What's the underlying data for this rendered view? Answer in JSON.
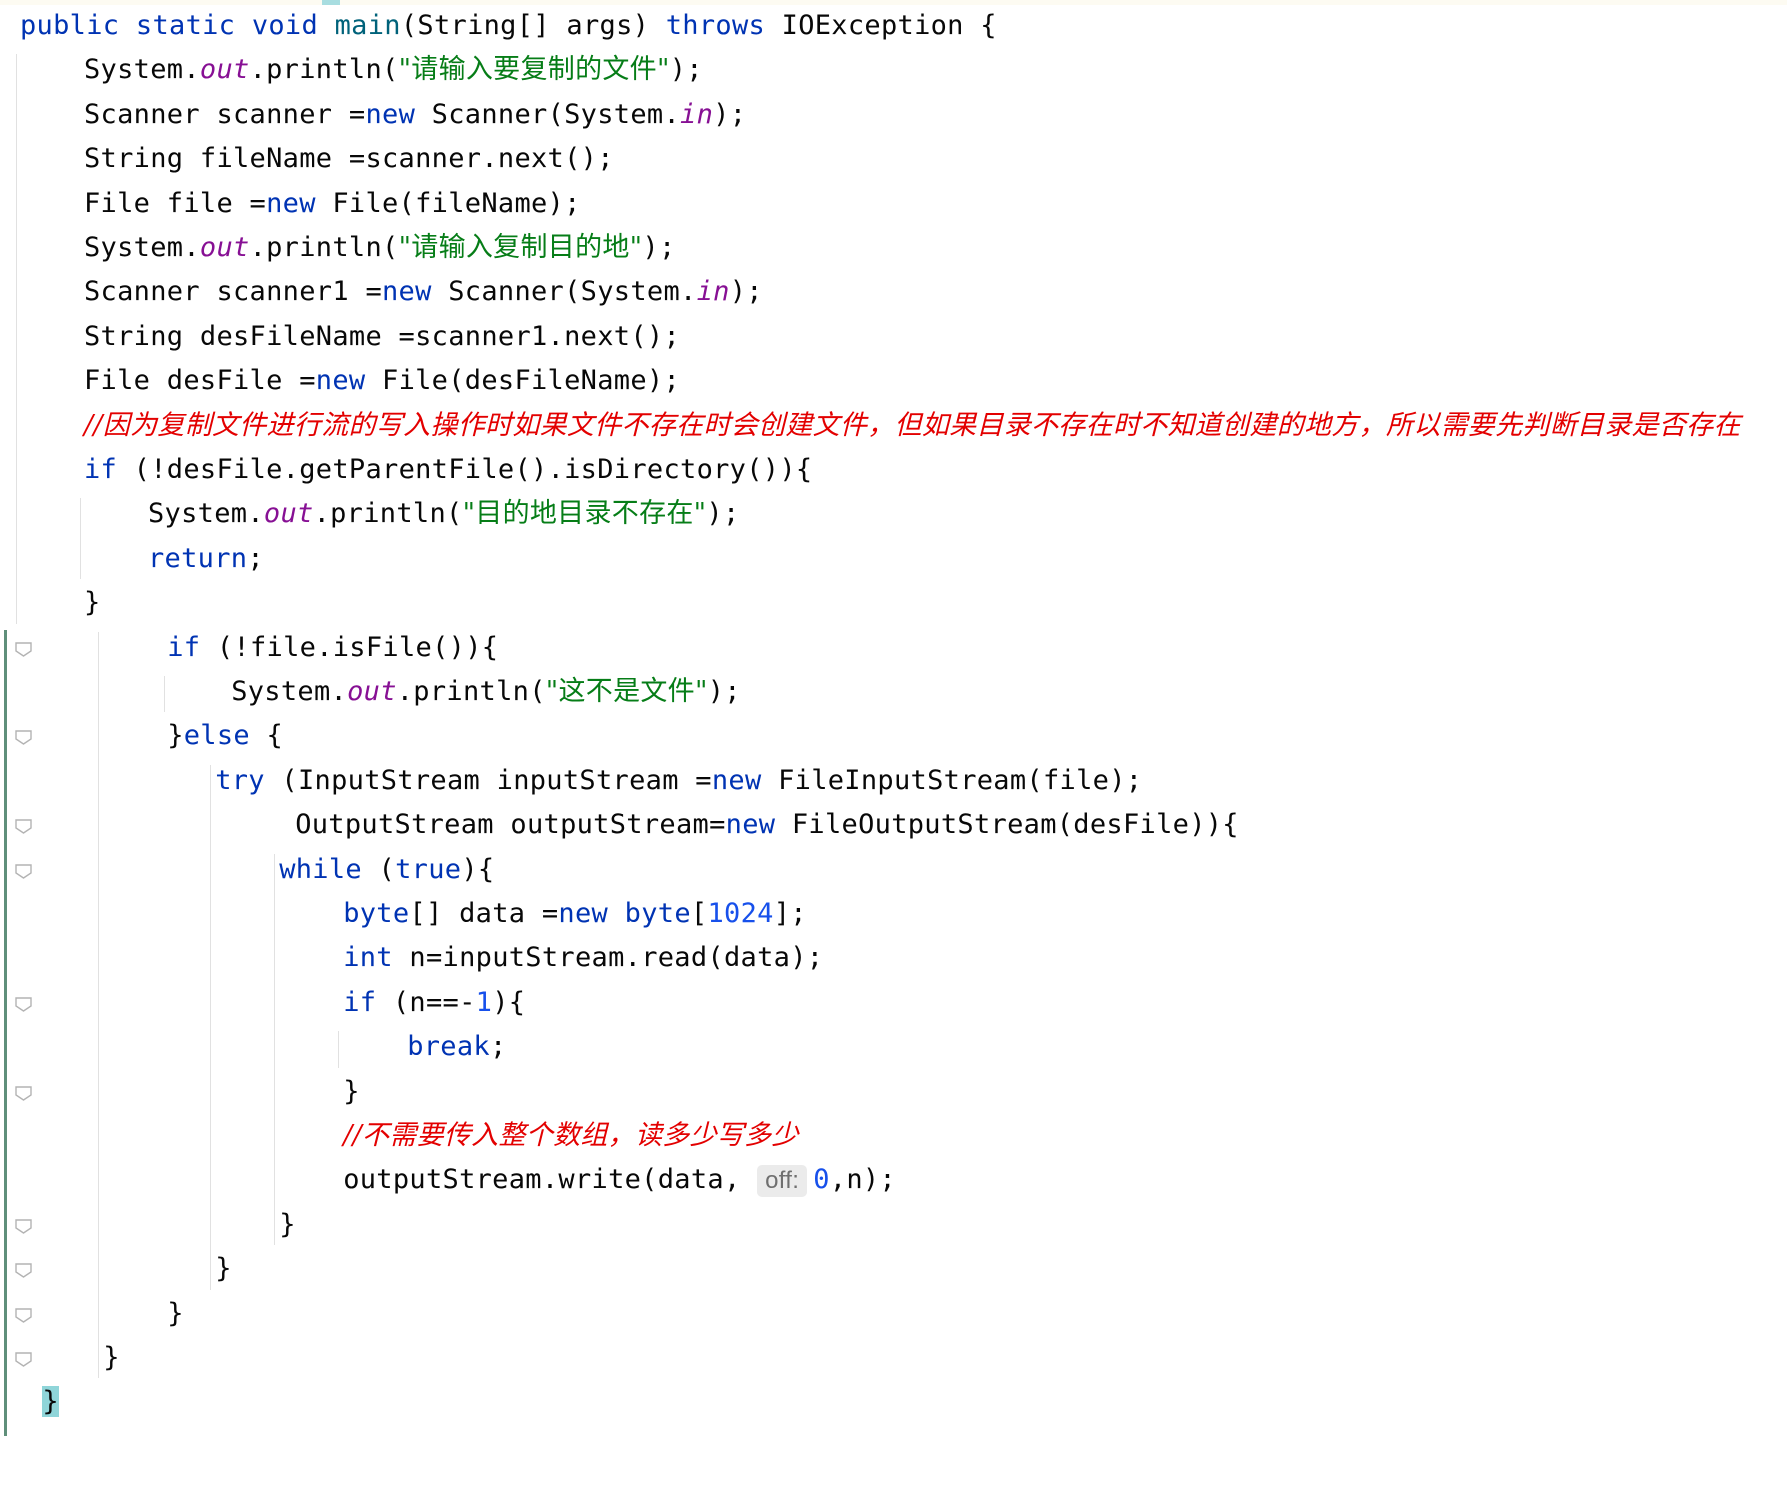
{
  "editor": {
    "language": "Java",
    "colors": {
      "keyword": "#0033b3",
      "string": "#067d17",
      "comment": "#e30000",
      "static_field": "#871094",
      "method_decl": "#00627a",
      "number": "#1750eb",
      "brace_highlight": "#8fd5d9",
      "change_bar": "#5f8f7a"
    },
    "lines": [
      {
        "indent": 0,
        "tokens": [
          {
            "t": "public",
            "c": "kw"
          },
          {
            "t": " "
          },
          {
            "t": "static",
            "c": "kw"
          },
          {
            "t": " "
          },
          {
            "t": "void",
            "c": "kw"
          },
          {
            "t": " "
          },
          {
            "t": "main",
            "c": "fn"
          },
          {
            "t": "(String[] args) "
          },
          {
            "t": "throws",
            "c": "kw"
          },
          {
            "t": " IOException {"
          }
        ]
      },
      {
        "indent": 1,
        "tokens": [
          {
            "t": "System."
          },
          {
            "t": "out",
            "c": "fld"
          },
          {
            "t": ".println("
          },
          {
            "t": "\"请输入要复制的文件\"",
            "c": "str"
          },
          {
            "t": ");"
          }
        ]
      },
      {
        "indent": 1,
        "tokens": [
          {
            "t": "Scanner scanner ="
          },
          {
            "t": "new",
            "c": "kw"
          },
          {
            "t": " Scanner(System."
          },
          {
            "t": "in",
            "c": "fld"
          },
          {
            "t": ");"
          }
        ]
      },
      {
        "indent": 1,
        "tokens": [
          {
            "t": "String fileName =scanner.next();"
          }
        ]
      },
      {
        "indent": 1,
        "tokens": [
          {
            "t": "File file ="
          },
          {
            "t": "new",
            "c": "kw"
          },
          {
            "t": " File(fileName);"
          }
        ]
      },
      {
        "indent": 1,
        "tokens": [
          {
            "t": "System."
          },
          {
            "t": "out",
            "c": "fld"
          },
          {
            "t": ".println("
          },
          {
            "t": "\"请输入复制目的地\"",
            "c": "str"
          },
          {
            "t": ");"
          }
        ]
      },
      {
        "indent": 1,
        "tokens": [
          {
            "t": "Scanner scanner1 ="
          },
          {
            "t": "new",
            "c": "kw"
          },
          {
            "t": " Scanner(System."
          },
          {
            "t": "in",
            "c": "fld"
          },
          {
            "t": ");"
          }
        ]
      },
      {
        "indent": 1,
        "tokens": [
          {
            "t": "String desFileName =scanner1.next();"
          }
        ]
      },
      {
        "indent": 1,
        "tokens": [
          {
            "t": "File desFile ="
          },
          {
            "t": "new",
            "c": "kw"
          },
          {
            "t": " File(desFileName);"
          }
        ]
      },
      {
        "indent": 1,
        "tokens": [
          {
            "t": "//因为复制文件进行流的写入操作时如果文件不存在时会创建文件，但如果目录不存在时不知道创建的地方，所以需要先判断目录是否存在",
            "c": "cmt"
          }
        ]
      },
      {
        "indent": 1,
        "tokens": [
          {
            "t": "if",
            "c": "kw"
          },
          {
            "t": " (!desFile.getParentFile().isDirectory()){"
          }
        ]
      },
      {
        "indent": 2,
        "tokens": [
          {
            "t": "System."
          },
          {
            "t": "out",
            "c": "fld"
          },
          {
            "t": ".println("
          },
          {
            "t": "\"目的地目录不存在\"",
            "c": "str"
          },
          {
            "t": ");"
          }
        ]
      },
      {
        "indent": 2,
        "tokens": [
          {
            "t": "return",
            "c": "kw"
          },
          {
            "t": ";"
          }
        ]
      },
      {
        "indent": 1,
        "tokens": [
          {
            "t": "}"
          }
        ]
      },
      {
        "indent": 2.3,
        "fold": true,
        "tokens": [
          {
            "t": "if",
            "c": "kw"
          },
          {
            "t": " (!file.isFile()){"
          }
        ]
      },
      {
        "indent": 3.3,
        "tokens": [
          {
            "t": "System."
          },
          {
            "t": "out",
            "c": "fld"
          },
          {
            "t": ".println("
          },
          {
            "t": "\"这不是文件\"",
            "c": "str"
          },
          {
            "t": ");"
          }
        ]
      },
      {
        "indent": 2.3,
        "fold": true,
        "tokens": [
          {
            "t": "}"
          },
          {
            "t": "else",
            "c": "kw"
          },
          {
            "t": " {"
          }
        ]
      },
      {
        "indent": 3.05,
        "tokens": [
          {
            "t": "try",
            "c": "kw"
          },
          {
            "t": " (InputStream inputStream ="
          },
          {
            "t": "new",
            "c": "kw"
          },
          {
            "t": " FileInputStream(file);"
          }
        ]
      },
      {
        "indent": 4.3,
        "fold": true,
        "tokens": [
          {
            "t": "OutputStream outputStream="
          },
          {
            "t": "new",
            "c": "kw"
          },
          {
            "t": " FileOutputStream(desFile)){"
          }
        ]
      },
      {
        "indent": 4.05,
        "fold": true,
        "tokens": [
          {
            "t": "while",
            "c": "kw"
          },
          {
            "t": " ("
          },
          {
            "t": "true",
            "c": "kw"
          },
          {
            "t": "){"
          }
        ]
      },
      {
        "indent": 5.05,
        "tokens": [
          {
            "t": "byte",
            "c": "kw"
          },
          {
            "t": "[] data ="
          },
          {
            "t": "new",
            "c": "kw"
          },
          {
            "t": " "
          },
          {
            "t": "byte",
            "c": "kw"
          },
          {
            "t": "["
          },
          {
            "t": "1024",
            "c": "num"
          },
          {
            "t": "];"
          }
        ]
      },
      {
        "indent": 5.05,
        "tokens": [
          {
            "t": "int",
            "c": "kw"
          },
          {
            "t": " n=inputStream.read(data);"
          }
        ]
      },
      {
        "indent": 5.05,
        "fold": true,
        "tokens": [
          {
            "t": "if",
            "c": "kw"
          },
          {
            "t": " (n==-"
          },
          {
            "t": "1",
            "c": "num"
          },
          {
            "t": "){"
          }
        ]
      },
      {
        "indent": 6.05,
        "tokens": [
          {
            "t": "break",
            "c": "kw"
          },
          {
            "t": ";"
          }
        ]
      },
      {
        "indent": 5.05,
        "fold": true,
        "tokens": [
          {
            "t": "}"
          }
        ]
      },
      {
        "indent": 5.05,
        "tokens": [
          {
            "t": "//不需要传入整个数组，读多少写多少",
            "c": "cmt"
          }
        ]
      },
      {
        "indent": 5.05,
        "tokens": [
          {
            "t": "outputStream.write(data, "
          },
          {
            "t": "off:",
            "c": "hint"
          },
          {
            "t": "0",
            "c": "num"
          },
          {
            "t": ",n);"
          }
        ]
      },
      {
        "indent": 4.05,
        "fold": true,
        "tokens": [
          {
            "t": "}"
          }
        ]
      },
      {
        "indent": 3.05,
        "fold": true,
        "tokens": [
          {
            "t": "}"
          }
        ]
      },
      {
        "indent": 2.3,
        "fold": true,
        "tokens": [
          {
            "t": "}"
          }
        ]
      },
      {
        "indent": 1.3,
        "fold": true,
        "tokens": [
          {
            "t": "}"
          }
        ]
      },
      {
        "indent": 0.35,
        "tokens": [
          {
            "t": "}",
            "c": "brace-hl"
          }
        ]
      }
    ]
  }
}
